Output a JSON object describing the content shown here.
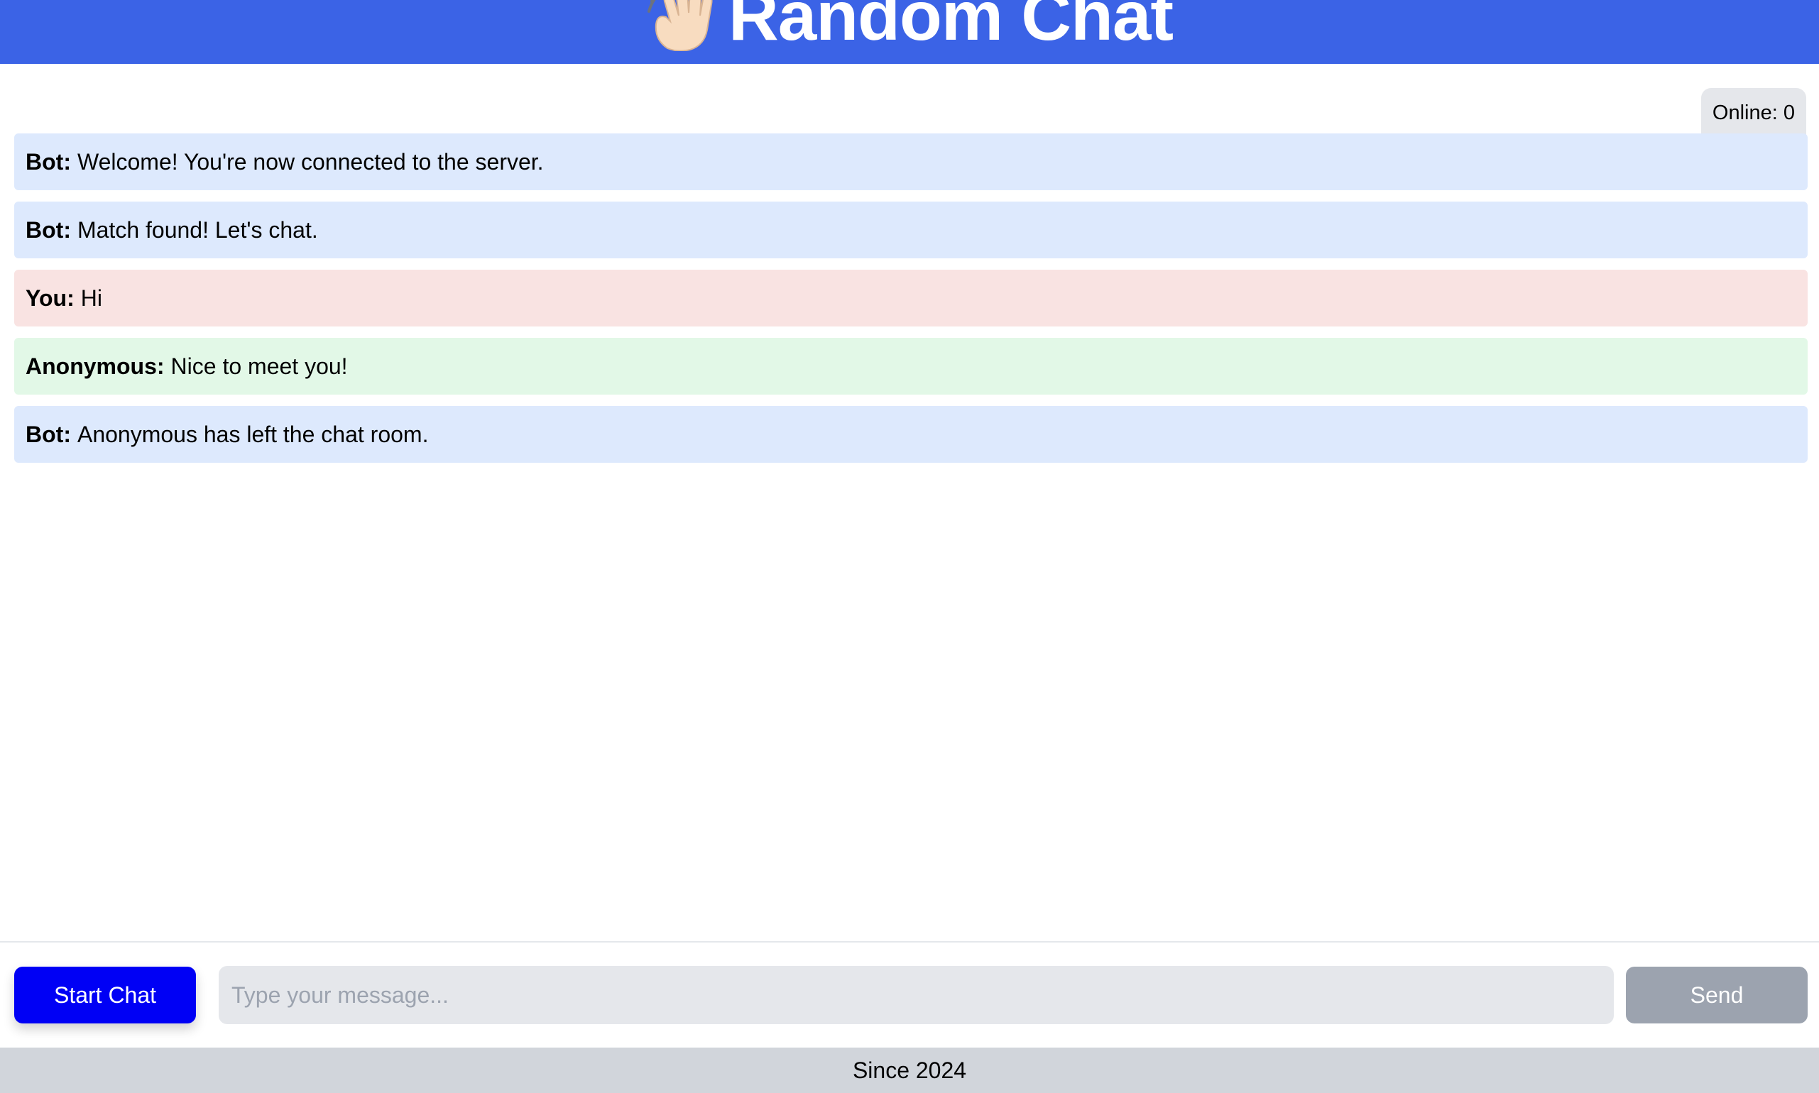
{
  "header": {
    "title": "Random Chat",
    "icon": "waving-hand-icon",
    "background": "#3b63e6"
  },
  "status": {
    "online_label": "Online: 0"
  },
  "messages": [
    {
      "sender": "Bot:",
      "text": "Welcome! You're now connected to the server.",
      "type": "bot"
    },
    {
      "sender": "Bot:",
      "text": "Match found! Let's chat.",
      "type": "bot"
    },
    {
      "sender": "You:",
      "text": "Hi",
      "type": "you"
    },
    {
      "sender": "Anonymous:",
      "text": "Nice to meet you!",
      "type": "anon"
    },
    {
      "sender": "Bot:",
      "text": "Anonymous has left the chat room.",
      "type": "bot"
    }
  ],
  "composer": {
    "start_label": "Start Chat",
    "placeholder": "Type your message...",
    "value": "",
    "send_label": "Send"
  },
  "footer": {
    "text": "Since 2024"
  },
  "colors": {
    "bot_bubble": "#dde9fd",
    "you_bubble": "#f9e3e2",
    "anon_bubble": "#e2f8e7",
    "start_button": "#0000f5",
    "send_button_disabled": "#9ca3af"
  }
}
